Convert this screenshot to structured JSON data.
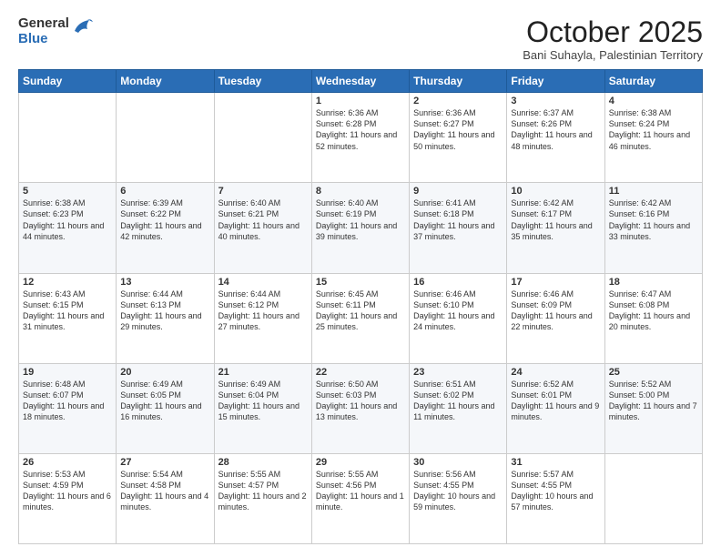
{
  "header": {
    "logo_general": "General",
    "logo_blue": "Blue",
    "main_title": "October 2025",
    "subtitle": "Bani Suhayla, Palestinian Territory"
  },
  "days_of_week": [
    "Sunday",
    "Monday",
    "Tuesday",
    "Wednesday",
    "Thursday",
    "Friday",
    "Saturday"
  ],
  "weeks": [
    [
      {
        "day": "",
        "info": ""
      },
      {
        "day": "",
        "info": ""
      },
      {
        "day": "",
        "info": ""
      },
      {
        "day": "1",
        "info": "Sunrise: 6:36 AM\nSunset: 6:28 PM\nDaylight: 11 hours\nand 52 minutes."
      },
      {
        "day": "2",
        "info": "Sunrise: 6:36 AM\nSunset: 6:27 PM\nDaylight: 11 hours\nand 50 minutes."
      },
      {
        "day": "3",
        "info": "Sunrise: 6:37 AM\nSunset: 6:26 PM\nDaylight: 11 hours\nand 48 minutes."
      },
      {
        "day": "4",
        "info": "Sunrise: 6:38 AM\nSunset: 6:24 PM\nDaylight: 11 hours\nand 46 minutes."
      }
    ],
    [
      {
        "day": "5",
        "info": "Sunrise: 6:38 AM\nSunset: 6:23 PM\nDaylight: 11 hours\nand 44 minutes."
      },
      {
        "day": "6",
        "info": "Sunrise: 6:39 AM\nSunset: 6:22 PM\nDaylight: 11 hours\nand 42 minutes."
      },
      {
        "day": "7",
        "info": "Sunrise: 6:40 AM\nSunset: 6:21 PM\nDaylight: 11 hours\nand 40 minutes."
      },
      {
        "day": "8",
        "info": "Sunrise: 6:40 AM\nSunset: 6:19 PM\nDaylight: 11 hours\nand 39 minutes."
      },
      {
        "day": "9",
        "info": "Sunrise: 6:41 AM\nSunset: 6:18 PM\nDaylight: 11 hours\nand 37 minutes."
      },
      {
        "day": "10",
        "info": "Sunrise: 6:42 AM\nSunset: 6:17 PM\nDaylight: 11 hours\nand 35 minutes."
      },
      {
        "day": "11",
        "info": "Sunrise: 6:42 AM\nSunset: 6:16 PM\nDaylight: 11 hours\nand 33 minutes."
      }
    ],
    [
      {
        "day": "12",
        "info": "Sunrise: 6:43 AM\nSunset: 6:15 PM\nDaylight: 11 hours\nand 31 minutes."
      },
      {
        "day": "13",
        "info": "Sunrise: 6:44 AM\nSunset: 6:13 PM\nDaylight: 11 hours\nand 29 minutes."
      },
      {
        "day": "14",
        "info": "Sunrise: 6:44 AM\nSunset: 6:12 PM\nDaylight: 11 hours\nand 27 minutes."
      },
      {
        "day": "15",
        "info": "Sunrise: 6:45 AM\nSunset: 6:11 PM\nDaylight: 11 hours\nand 25 minutes."
      },
      {
        "day": "16",
        "info": "Sunrise: 6:46 AM\nSunset: 6:10 PM\nDaylight: 11 hours\nand 24 minutes."
      },
      {
        "day": "17",
        "info": "Sunrise: 6:46 AM\nSunset: 6:09 PM\nDaylight: 11 hours\nand 22 minutes."
      },
      {
        "day": "18",
        "info": "Sunrise: 6:47 AM\nSunset: 6:08 PM\nDaylight: 11 hours\nand 20 minutes."
      }
    ],
    [
      {
        "day": "19",
        "info": "Sunrise: 6:48 AM\nSunset: 6:07 PM\nDaylight: 11 hours\nand 18 minutes."
      },
      {
        "day": "20",
        "info": "Sunrise: 6:49 AM\nSunset: 6:05 PM\nDaylight: 11 hours\nand 16 minutes."
      },
      {
        "day": "21",
        "info": "Sunrise: 6:49 AM\nSunset: 6:04 PM\nDaylight: 11 hours\nand 15 minutes."
      },
      {
        "day": "22",
        "info": "Sunrise: 6:50 AM\nSunset: 6:03 PM\nDaylight: 11 hours\nand 13 minutes."
      },
      {
        "day": "23",
        "info": "Sunrise: 6:51 AM\nSunset: 6:02 PM\nDaylight: 11 hours\nand 11 minutes."
      },
      {
        "day": "24",
        "info": "Sunrise: 6:52 AM\nSunset: 6:01 PM\nDaylight: 11 hours\nand 9 minutes."
      },
      {
        "day": "25",
        "info": "Sunrise: 5:52 AM\nSunset: 5:00 PM\nDaylight: 11 hours\nand 7 minutes."
      }
    ],
    [
      {
        "day": "26",
        "info": "Sunrise: 5:53 AM\nSunset: 4:59 PM\nDaylight: 11 hours\nand 6 minutes."
      },
      {
        "day": "27",
        "info": "Sunrise: 5:54 AM\nSunset: 4:58 PM\nDaylight: 11 hours\nand 4 minutes."
      },
      {
        "day": "28",
        "info": "Sunrise: 5:55 AM\nSunset: 4:57 PM\nDaylight: 11 hours\nand 2 minutes."
      },
      {
        "day": "29",
        "info": "Sunrise: 5:55 AM\nSunset: 4:56 PM\nDaylight: 11 hours\nand 1 minute."
      },
      {
        "day": "30",
        "info": "Sunrise: 5:56 AM\nSunset: 4:55 PM\nDaylight: 10 hours\nand 59 minutes."
      },
      {
        "day": "31",
        "info": "Sunrise: 5:57 AM\nSunset: 4:55 PM\nDaylight: 10 hours\nand 57 minutes."
      },
      {
        "day": "",
        "info": ""
      }
    ]
  ]
}
